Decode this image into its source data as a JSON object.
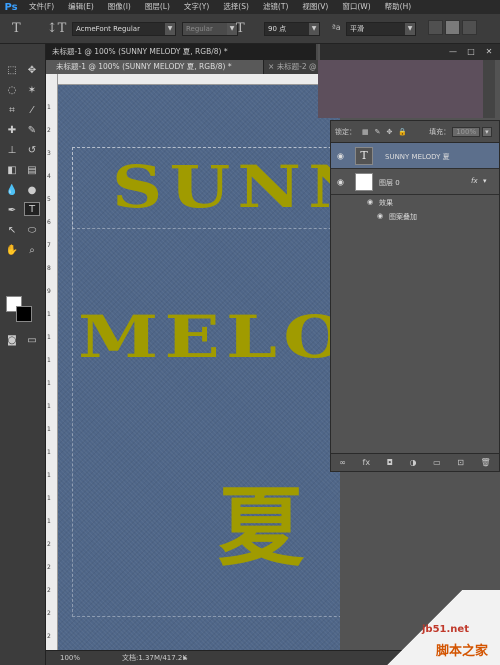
{
  "menubar": {
    "logo": "Ps",
    "items": [
      "文件(F)",
      "编辑(E)",
      "图像(I)",
      "图层(L)",
      "文字(Y)",
      "选择(S)",
      "滤镜(T)",
      "视图(V)",
      "窗口(W)",
      "帮助(H)"
    ],
    "window_controls": [
      "—",
      "□",
      "✕"
    ]
  },
  "options": {
    "font_family": "AcmeFont Regular",
    "font_style": "Regular",
    "font_size": "90 点",
    "aa_label": "ªa",
    "antialias": "平滑"
  },
  "document": {
    "title": "未标题-1 @ 100% (SUNNY  MELODY 夏, RGB/8) *",
    "tabs": [
      "未标题-1 @ 100% (SUNNY  MELODY 夏, RGB/8) *",
      "未标题-2 @"
    ],
    "tab_close": "×"
  },
  "ruler_numbers": [
    "1",
    "2",
    "3",
    "4",
    "5",
    "6",
    "7",
    "8",
    "9",
    "1",
    "1",
    "1",
    "1",
    "1",
    "1",
    "1",
    "1",
    "1",
    "1",
    "2",
    "2",
    "2",
    "2",
    "2"
  ],
  "canvas": {
    "line1": "SUNN",
    "line2": "MELO",
    "line3": "夏"
  },
  "layers": {
    "lock_label": "锁定：",
    "fill_label": "填充：",
    "fill_value": "100%",
    "rows": [
      {
        "name": "SUNNY MELODY 夏",
        "thumb": "T"
      },
      {
        "name": "图层 0",
        "fx": "fx"
      }
    ],
    "effects_label": "效果",
    "pattern_overlay": "图案叠加"
  },
  "status": {
    "zoom": "100%",
    "doc": "文档:1.37M/417.2K"
  },
  "watermark": {
    "site": "jb51.net",
    "name": "脚本之家"
  }
}
